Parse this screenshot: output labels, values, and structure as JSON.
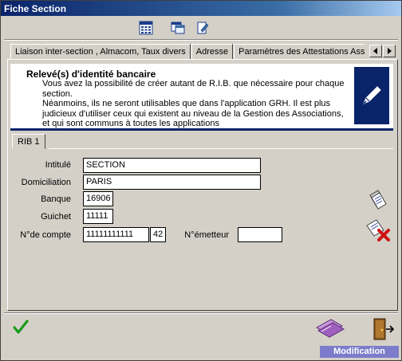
{
  "window": {
    "title": "Fiche Section"
  },
  "toolbar": {
    "icons": [
      "calculator-icon",
      "window-icon",
      "edit-note-icon"
    ]
  },
  "tabs": [
    {
      "label": "Liaison inter-section , Almacom, Taux divers"
    },
    {
      "label": "Adresse"
    },
    {
      "label": "Paramètres des Attestations Assedic"
    }
  ],
  "info": {
    "title": "Relevé(s) d'identité bancaire",
    "line1": "Vous avez la possibilité de créer autant de R.I.B. que nécessaire pour chaque section.",
    "line2": "Néanmoins, ils ne seront utilisables que dans l'application GRH. Il est plus judicieux d'utiliser ceux qui existent au niveau de la Gestion des Associations, et qui sont communs à toutes les applications"
  },
  "subtab": {
    "label": "RIB 1"
  },
  "form": {
    "intitule_label": "Intitulé",
    "intitule_value": "SECTION",
    "domiciliation_label": "Domiciliation",
    "domiciliation_value": "PARIS",
    "banque_label": "Banque",
    "banque_value": "16906",
    "guichet_label": "Guichet",
    "guichet_value": "11111",
    "compte_label": "N°de compte",
    "compte_value": "11111111111",
    "cle_value": "42",
    "emetteur_label": "N°émetteur",
    "emetteur_value": ""
  },
  "status": {
    "mode": "Modification"
  },
  "colors": {
    "title_start": "#0a246a",
    "status_bg": "#7c7ccb",
    "accent": "#0a246a"
  }
}
